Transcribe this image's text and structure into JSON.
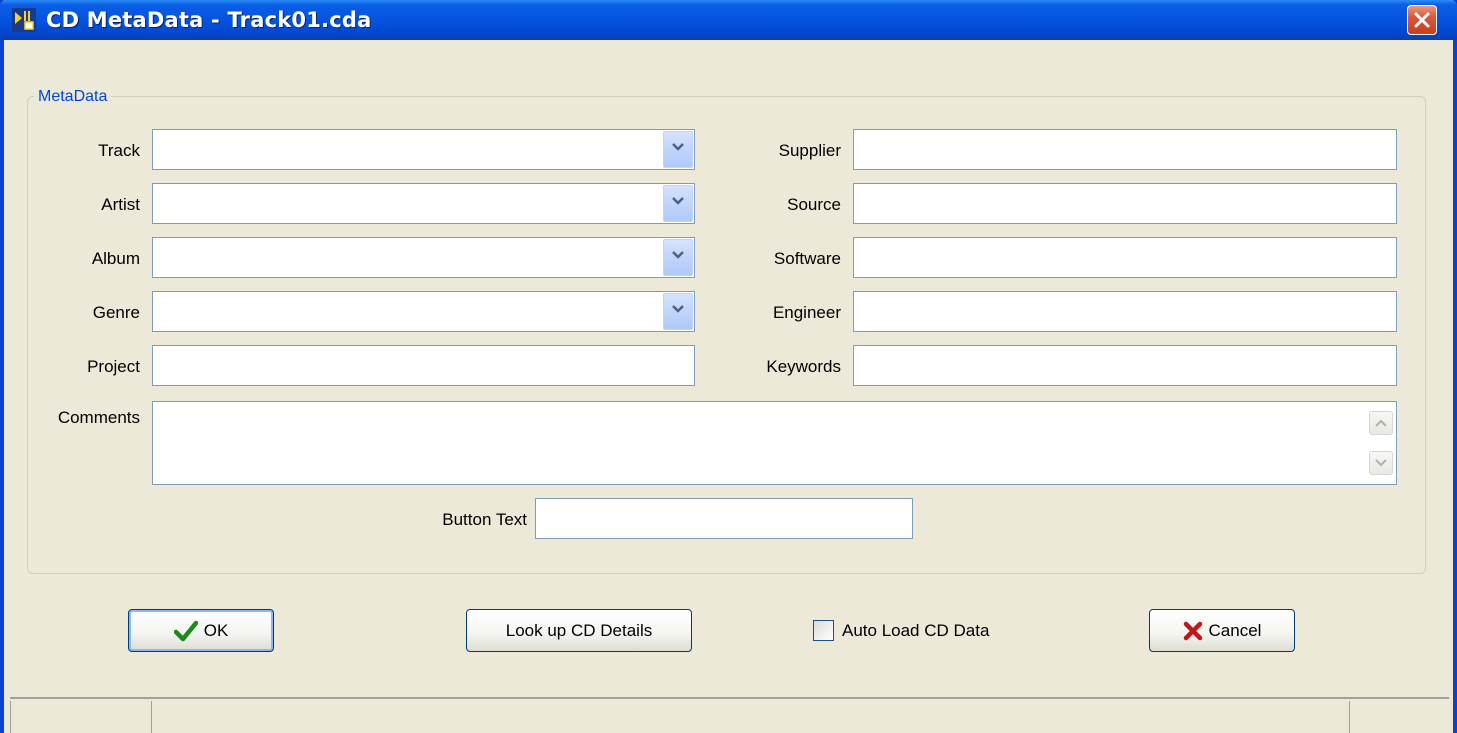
{
  "window": {
    "title": "CD MetaData - Track01.cda",
    "icon": "audio-metadata-icon",
    "close_icon": "close-x-icon",
    "close_color": "#d8573b",
    "titlebar_color": "#0553e0"
  },
  "group": {
    "legend": "MetaData"
  },
  "fields_left": [
    {
      "label": "Track",
      "value": "",
      "type": "combo"
    },
    {
      "label": "Artist",
      "value": "",
      "type": "combo"
    },
    {
      "label": "Album",
      "value": "",
      "type": "combo"
    },
    {
      "label": "Genre",
      "value": "",
      "type": "combo"
    },
    {
      "label": "Project",
      "value": "",
      "type": "text"
    }
  ],
  "fields_right": [
    {
      "label": "Supplier",
      "value": ""
    },
    {
      "label": "Source",
      "value": ""
    },
    {
      "label": "Software",
      "value": ""
    },
    {
      "label": "Engineer",
      "value": ""
    },
    {
      "label": "Keywords",
      "value": ""
    }
  ],
  "comments": {
    "label": "Comments",
    "value": ""
  },
  "button_text": {
    "label": "Button Text",
    "value": ""
  },
  "buttons": {
    "ok": {
      "label": "OK",
      "icon": "checkmark-icon"
    },
    "lookup": {
      "label": "Look up CD Details"
    },
    "cancel": {
      "label": "Cancel",
      "icon": "red-x-icon"
    }
  },
  "auto_load": {
    "label": "Auto Load CD Data",
    "checked": false
  }
}
